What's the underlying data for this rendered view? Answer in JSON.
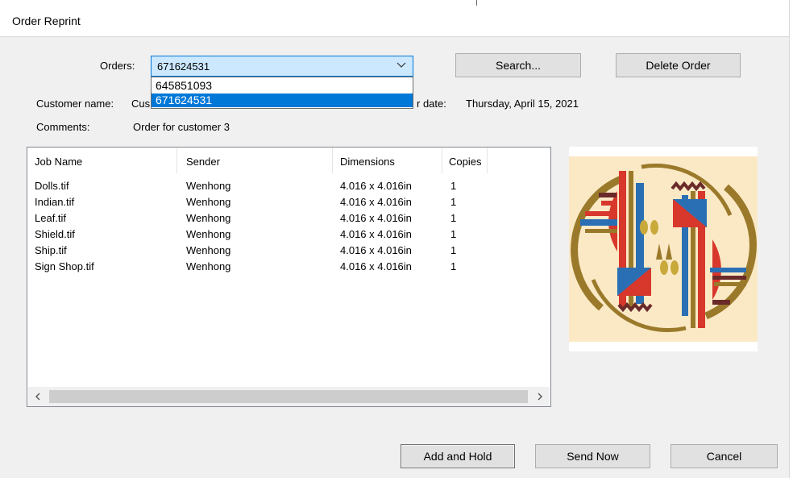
{
  "window": {
    "title": "Order Reprint"
  },
  "orders": {
    "label": "Orders:",
    "selected": "671624531",
    "options": [
      "645851093",
      "671624531"
    ]
  },
  "customer": {
    "name_label": "Customer name:",
    "name_value_partial": "Cus",
    "order_date_label_partial": "r date:",
    "order_date_value": "Thursday, April 15, 2021"
  },
  "comments": {
    "label": "Comments:",
    "value": "Order for customer 3"
  },
  "buttons": {
    "search": "Search...",
    "delete_order": "Delete Order",
    "add_and_hold": "Add and Hold",
    "send_now": "Send Now",
    "cancel": "Cancel"
  },
  "jobs": {
    "columns": [
      "Job Name",
      "Sender",
      "Dimensions",
      "Copies"
    ],
    "rows": [
      [
        "Dolls.tif",
        "Wenhong",
        "4.016 x 4.016in",
        "1"
      ],
      [
        "Indian.tif",
        "Wenhong",
        "4.016 x 4.016in",
        "1"
      ],
      [
        "Leaf.tif",
        "Wenhong",
        "4.016 x 4.016in",
        "1"
      ],
      [
        "Shield.tif",
        "Wenhong",
        "4.016 x 4.016in",
        "1"
      ],
      [
        "Ship.tif",
        "Wenhong",
        "4.016 x 4.016in",
        "1"
      ],
      [
        "Sign Shop.tif",
        "Wenhong",
        "4.016 x 4.016in",
        "1"
      ]
    ]
  },
  "colors": {
    "selection": "#0078d7",
    "combo_bg": "#cce8ff",
    "dialog_bg": "#f0f0f0",
    "art_bg": "#fbe9c6",
    "art_red": "#d8372b",
    "art_blue": "#2a6fb4",
    "art_olive": "#9a7a2a",
    "art_maroon": "#6b2a2a"
  },
  "icons": {
    "combo_arrow": "chevron-down-icon",
    "scroll_left": "chevron-left-icon",
    "scroll_right": "chevron-right-icon"
  }
}
